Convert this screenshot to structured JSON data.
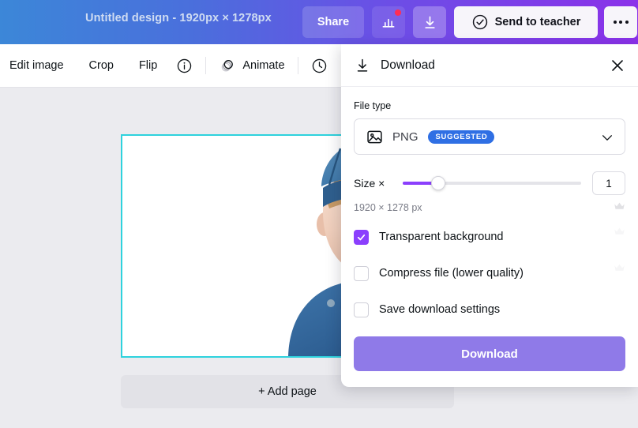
{
  "header": {
    "doc_title": "Untitled design - 1920px × 1278px",
    "share_label": "Share",
    "chart_icon": "bar-chart-icon",
    "download_icon": "download-icon",
    "send_to_teacher_label": "Send to teacher",
    "send_to_teacher_icon": "check-circle-icon",
    "more_label": "more-options-icon",
    "gradient_start": "#3c87d8",
    "gradient_end": "#8b31e9",
    "notification_dot_color": "#ff2d55"
  },
  "toolbar": {
    "items": [
      {
        "label": "Edit image",
        "icon": ""
      },
      {
        "label": "Crop",
        "icon": ""
      },
      {
        "label": "Flip",
        "icon": ""
      },
      {
        "label": "",
        "icon": "info-icon"
      },
      {
        "label": "Animate",
        "icon": "animate-icon"
      },
      {
        "label": "",
        "icon": "clock-icon"
      }
    ]
  },
  "canvas": {
    "selection_color": "#2ed2dd",
    "background": "#ebebef",
    "add_page_label": "+ Add page",
    "photo_alt": "child-portrait-photo"
  },
  "panel": {
    "title": "Download",
    "title_icon": "download-icon",
    "close_icon": "close-icon",
    "file_type_label": "File type",
    "file_type": {
      "icon": "image-file-icon",
      "value": "PNG",
      "badge": "SUGGESTED",
      "badge_color": "#2f6fe4",
      "chevron": "chevron-down-icon"
    },
    "size": {
      "label": "Size ×",
      "value": "1",
      "slider_percent": 20,
      "accent_color": "#8b3ffd",
      "dimensions": "1920 × 1278 px",
      "crown_icon": "crown-icon"
    },
    "options": [
      {
        "label": "Transparent background",
        "checked": true,
        "crown": "crown-icon"
      },
      {
        "label": "Compress file (lower quality)",
        "checked": false,
        "crown": "crown-icon"
      },
      {
        "label": "Save download settings",
        "checked": false,
        "crown": ""
      }
    ],
    "cta_label": "Download",
    "cta_color": "#8f7ae8"
  }
}
